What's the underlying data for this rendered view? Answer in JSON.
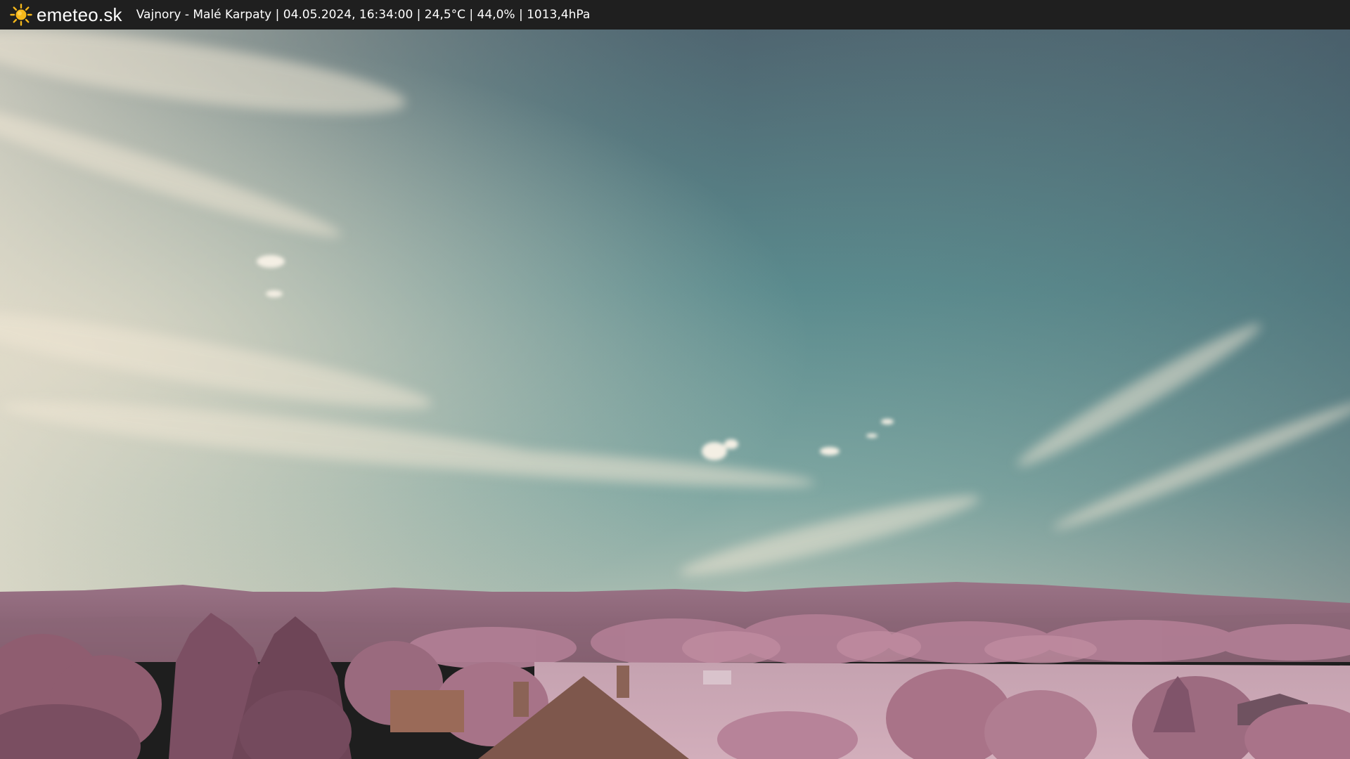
{
  "header": {
    "brand": "emeteo.sk",
    "logo_icon": "sun-icon",
    "station_info": "Vajnory - Malé Karpaty | 04.05.2024, 16:34:00 | 24,5°C | 44,0% | 1013,4hPa"
  },
  "colors": {
    "header_bg": "#1f1f1f",
    "sun": "#f6b81a",
    "sky_top": "#4b5f6a",
    "sky_mid": "#5b8b8e",
    "sky_haze": "#b7b8a7",
    "hills": "#9c6f84",
    "foliage": "#b67c92",
    "field": "#c8a0af",
    "roof": "#8a6058"
  }
}
